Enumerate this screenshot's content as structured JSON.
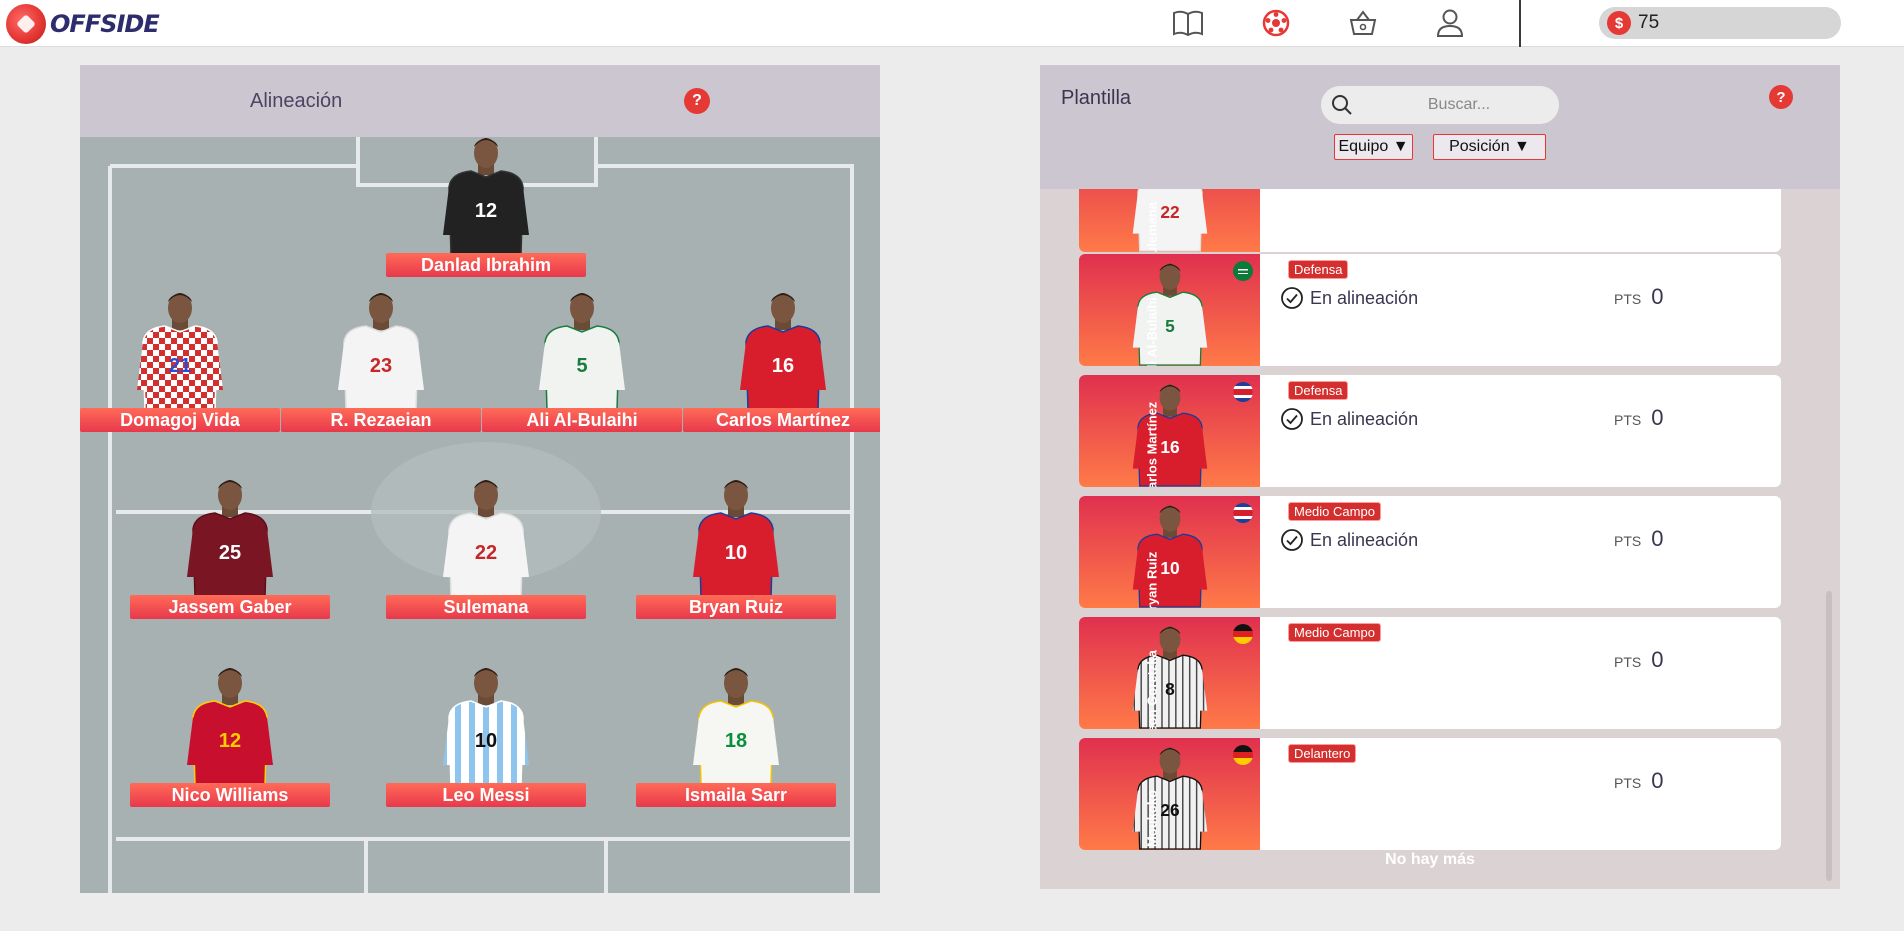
{
  "header": {
    "brand": "OFFSIDE",
    "nav": [
      "book-icon",
      "soccer-ball-icon",
      "basket-icon",
      "user-icon"
    ],
    "coins": {
      "symbol": "$",
      "value": "75"
    }
  },
  "lineup": {
    "title": "Alineación",
    "help": "?",
    "players": [
      {
        "name": "Danlad Ibrahim",
        "shirt": "12",
        "kit": "black"
      },
      {
        "name": "Domagoj Vida",
        "shirt": "21",
        "kit": "checkered"
      },
      {
        "name": "R. Rezaeian",
        "shirt": "23",
        "kit": "white"
      },
      {
        "name": "Ali Al-Bulaihi",
        "shirt": "5",
        "kit": "white-green"
      },
      {
        "name": "Carlos Martínez",
        "shirt": "16",
        "kit": "red"
      },
      {
        "name": "Jassem Gaber",
        "shirt": "25",
        "kit": "maroon"
      },
      {
        "name": "Sulemana",
        "shirt": "22",
        "kit": "white"
      },
      {
        "name": "Bryan Ruiz",
        "shirt": "10",
        "kit": "red"
      },
      {
        "name": "Nico Williams",
        "shirt": "12",
        "kit": "red-spain"
      },
      {
        "name": "Leo Messi",
        "shirt": "10",
        "kit": "stripes"
      },
      {
        "name": "Ismaila Sarr",
        "shirt": "18",
        "kit": "white-senegal"
      }
    ]
  },
  "squad": {
    "title": "Plantilla",
    "help": "?",
    "search_placeholder": "Buscar...",
    "filters": [
      "Equipo ▼",
      "Posición ▼"
    ],
    "pts_label": "PTS",
    "cards": [
      {
        "name": "Sulemana",
        "shirt": "22",
        "kit": "white",
        "position": "",
        "status": "",
        "pts": ""
      },
      {
        "name": "Ali Al-Bulaihi",
        "shirt": "5",
        "kit": "white-green",
        "flag": "saudi-flag-icon",
        "position": "Defensa",
        "status": "En alineación",
        "pts": "0"
      },
      {
        "name": "Carlos Martínez",
        "shirt": "16",
        "kit": "red",
        "flag": "costa-rica-flag-icon",
        "position": "Defensa",
        "status": "En alineación",
        "pts": "0"
      },
      {
        "name": "Bryan Ruiz",
        "shirt": "10",
        "kit": "red",
        "flag": "costa-rica-flag-icon",
        "position": "Medio Campo",
        "status": "En alineación",
        "pts": "0"
      },
      {
        "name": "Leon Goretzka",
        "shirt": "8",
        "kit": "germany",
        "flag": "germany-flag-icon",
        "position": "Medio Campo",
        "status": "",
        "pts": "0"
      },
      {
        "name": "Y. Moukoko",
        "shirt": "26",
        "kit": "germany",
        "flag": "germany-flag-icon",
        "position": "Delantero",
        "status": "",
        "pts": "0"
      }
    ],
    "end_text": "No hay más"
  },
  "colors": {
    "accent": "#e53935",
    "panel": "#ccc6d1",
    "pitch": "#a7b1b2"
  }
}
